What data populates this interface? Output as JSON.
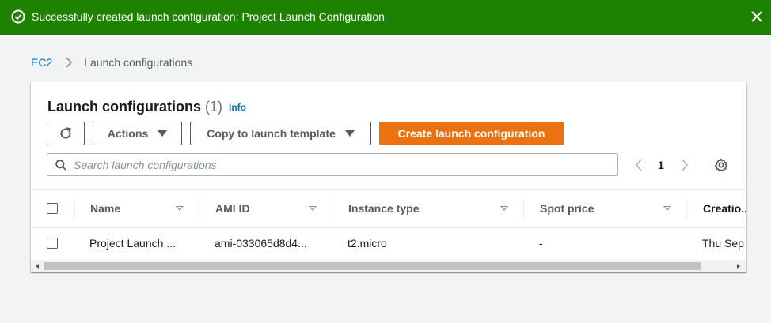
{
  "flash": {
    "message": "Successfully created launch configuration: Project Launch Configuration",
    "success_icon": "check-circle-icon",
    "close_icon": "close-icon",
    "color": "#1d8102"
  },
  "breadcrumb": {
    "root": "EC2",
    "current": "Launch configurations"
  },
  "header": {
    "title": "Launch configurations",
    "count": "(1)",
    "info": "Info"
  },
  "toolbar": {
    "refresh_icon": "refresh-icon",
    "actions_label": "Actions",
    "copy_label": "Copy to launch template",
    "create_label": "Create launch configuration",
    "create_color": "#ec7211"
  },
  "search": {
    "placeholder": "Search launch configurations",
    "value": ""
  },
  "pagination": {
    "page": "1"
  },
  "table": {
    "columns": [
      "Name",
      "AMI ID",
      "Instance type",
      "Spot price",
      "Creatio..."
    ],
    "rows": [
      {
        "name": "Project Launch ...",
        "ami_id": "ami-033065d8d4...",
        "instance_type": "t2.micro",
        "spot_price": "-",
        "creation": "Thu Sep"
      }
    ]
  }
}
